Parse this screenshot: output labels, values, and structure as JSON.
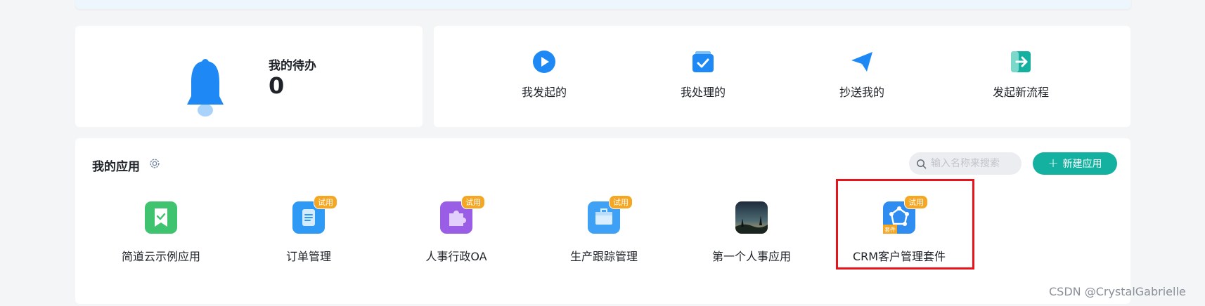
{
  "todo": {
    "label": "我的待办",
    "count": "0"
  },
  "flows": [
    {
      "label": "我发起的",
      "icon": "play-circle-icon"
    },
    {
      "label": "我处理的",
      "icon": "inbox-check-icon"
    },
    {
      "label": "抄送我的",
      "icon": "paper-plane-icon"
    },
    {
      "label": "发起新流程",
      "icon": "exit-arrow-icon"
    }
  ],
  "apps_section": {
    "title": "我的应用",
    "search_placeholder": "输入名称来搜索",
    "new_button": "新建应用",
    "trial_badge": "试用",
    "suite_badge": "套件",
    "items": [
      {
        "name": "简道云示例应用",
        "icon": "bookmark-check-icon",
        "trial": false
      },
      {
        "name": "订单管理",
        "icon": "document-icon",
        "trial": true
      },
      {
        "name": "人事行政OA",
        "icon": "puzzle-icon",
        "trial": true
      },
      {
        "name": "生产跟踪管理",
        "icon": "box-icon",
        "trial": true
      },
      {
        "name": "第一个人事应用",
        "icon": "landscape-photo-icon",
        "trial": false
      },
      {
        "name": "CRM客户管理套件",
        "icon": "network-icon",
        "trial": true
      }
    ]
  },
  "watermark": "CSDN @CrystalGabrielle",
  "colors": {
    "accent": "#14b0a0",
    "primary_blue": "#1e88f5",
    "trial": "#f5a623",
    "highlight": "#e8141b"
  }
}
